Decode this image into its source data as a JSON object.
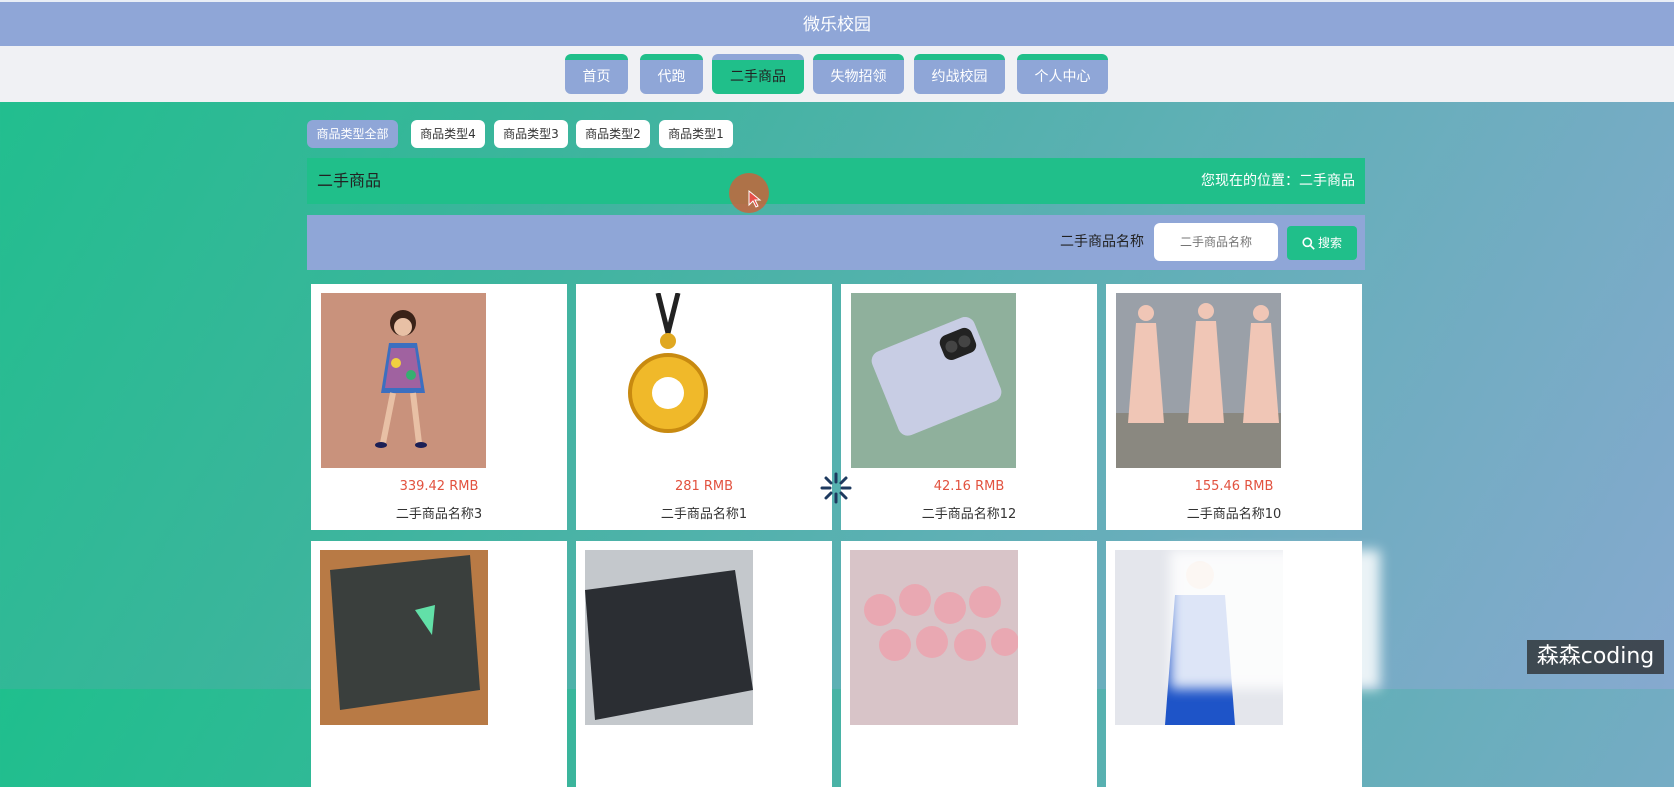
{
  "app": {
    "title": "微乐校园"
  },
  "nav": {
    "items": [
      {
        "label": "首页",
        "active": false
      },
      {
        "label": "代跑",
        "active": false
      },
      {
        "label": "二手商品",
        "active": true
      },
      {
        "label": "失物招领",
        "active": false
      },
      {
        "label": "约战校园",
        "active": false
      },
      {
        "label": "个人中心",
        "active": false
      }
    ]
  },
  "categories": [
    {
      "label": "商品类型全部",
      "active": true
    },
    {
      "label": "商品类型4",
      "active": false
    },
    {
      "label": "商品类型3",
      "active": false
    },
    {
      "label": "商品类型2",
      "active": false
    },
    {
      "label": "商品类型1",
      "active": false
    }
  ],
  "page": {
    "title": "二手商品",
    "location": "您现在的位置：二手商品"
  },
  "search": {
    "label": "二手商品名称",
    "placeholder": "二手商品名称",
    "button": "搜索"
  },
  "products": [
    {
      "price": "339.42 RMB",
      "name": "二手商品名称3",
      "image": "dress-photo"
    },
    {
      "price": "281 RMB",
      "name": "二手商品名称1",
      "image": "gold-pendant-photo"
    },
    {
      "price": "42.16 RMB",
      "name": "二手商品名称12",
      "image": "phone-photo"
    },
    {
      "price": "155.46 RMB",
      "name": "二手商品名称10",
      "image": "pink-dress-photo"
    },
    {
      "price": "",
      "name": "",
      "image": "laptop-photo"
    },
    {
      "price": "",
      "name": "",
      "image": "laptop-dark-photo"
    },
    {
      "price": "",
      "name": "",
      "image": "roses-photo"
    },
    {
      "price": "",
      "name": "",
      "image": "blue-outfit-photo"
    }
  ],
  "watermark": "森森coding",
  "colors": {
    "accent_green": "#20bf8a",
    "accent_blue": "#8fa6d7",
    "price_red": "#e2523f"
  }
}
